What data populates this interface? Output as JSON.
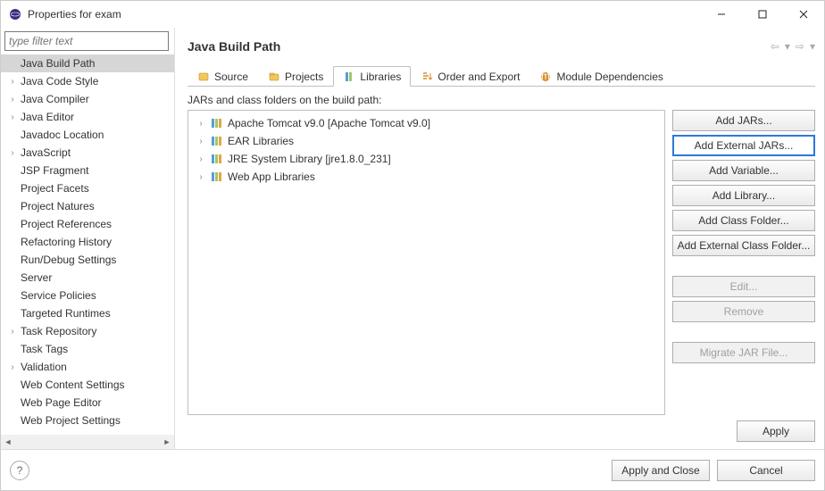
{
  "window": {
    "title": "Properties for exam"
  },
  "sidebar": {
    "filter_placeholder": "type filter text",
    "items": [
      {
        "label": "Java Build Path",
        "expandable": false,
        "selected": true
      },
      {
        "label": "Java Code Style",
        "expandable": true
      },
      {
        "label": "Java Compiler",
        "expandable": true
      },
      {
        "label": "Java Editor",
        "expandable": true
      },
      {
        "label": "Javadoc Location",
        "expandable": false
      },
      {
        "label": "JavaScript",
        "expandable": true
      },
      {
        "label": "JSP Fragment",
        "expandable": false
      },
      {
        "label": "Project Facets",
        "expandable": false
      },
      {
        "label": "Project Natures",
        "expandable": false
      },
      {
        "label": "Project References",
        "expandable": false
      },
      {
        "label": "Refactoring History",
        "expandable": false
      },
      {
        "label": "Run/Debug Settings",
        "expandable": false
      },
      {
        "label": "Server",
        "expandable": false
      },
      {
        "label": "Service Policies",
        "expandable": false
      },
      {
        "label": "Targeted Runtimes",
        "expandable": false
      },
      {
        "label": "Task Repository",
        "expandable": true
      },
      {
        "label": "Task Tags",
        "expandable": false
      },
      {
        "label": "Validation",
        "expandable": true
      },
      {
        "label": "Web Content Settings",
        "expandable": false
      },
      {
        "label": "Web Page Editor",
        "expandable": false
      },
      {
        "label": "Web Project Settings",
        "expandable": false
      }
    ]
  },
  "page": {
    "title": "Java Build Path",
    "tabs": [
      {
        "label": "Source",
        "icon": "source"
      },
      {
        "label": "Projects",
        "icon": "projects"
      },
      {
        "label": "Libraries",
        "icon": "libraries",
        "active": true
      },
      {
        "label": "Order and Export",
        "icon": "order"
      },
      {
        "label": "Module Dependencies",
        "icon": "module"
      }
    ],
    "sublabel": "JARs and class folders on the build path:",
    "jars": [
      {
        "label": "Apache Tomcat v9.0 [Apache Tomcat v9.0]"
      },
      {
        "label": "EAR Libraries"
      },
      {
        "label": "JRE System Library [jre1.8.0_231]"
      },
      {
        "label": "Web App Libraries"
      }
    ],
    "buttons": {
      "add_jars": "Add JARs...",
      "add_external_jars": "Add External JARs...",
      "add_variable": "Add Variable...",
      "add_library": "Add Library...",
      "add_class_folder": "Add Class Folder...",
      "add_external_class_folder": "Add External Class Folder...",
      "edit": "Edit...",
      "remove": "Remove",
      "migrate": "Migrate JAR File..."
    },
    "apply": "Apply"
  },
  "footer": {
    "apply_close": "Apply and Close",
    "cancel": "Cancel"
  }
}
